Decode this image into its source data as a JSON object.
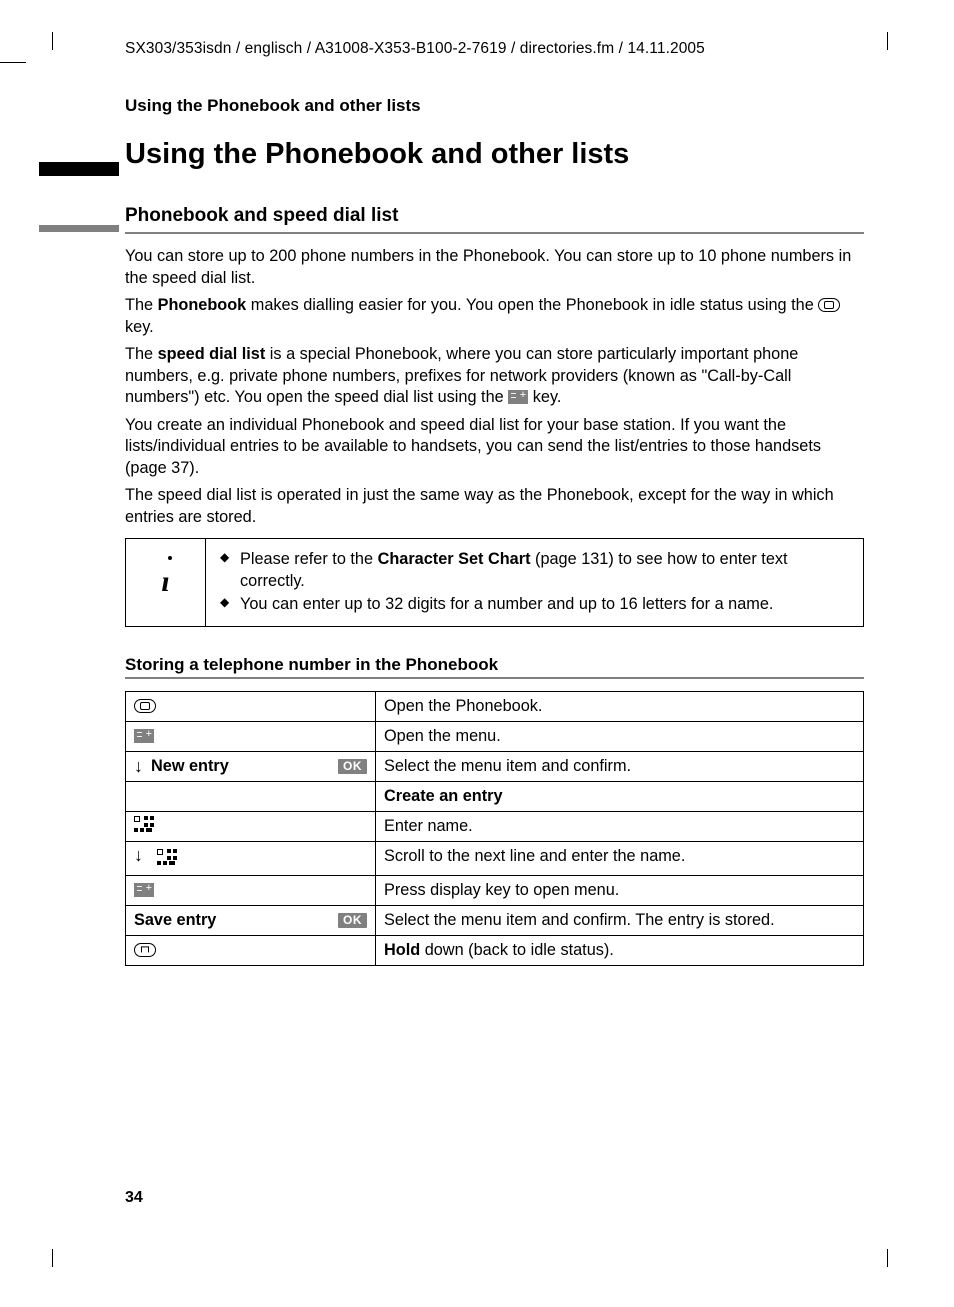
{
  "headerPath": "SX303/353isdn / englisch / A31008-X353-B100-2-7619 / directories.fm / 14.11.2005",
  "runningHead": "Using the Phonebook and other lists",
  "h1": "Using the Phonebook and other lists",
  "h2": "Phonebook and speed dial list",
  "para1": "You can store up to 200 phone numbers in the Phonebook. You can store up to 10 phone numbers in the speed dial list.",
  "para2a": "The ",
  "para2b": "Phonebook",
  "para2c": " makes dialling easier for you. You open the Phonebook in idle status using the ",
  "para2d": " key.",
  "para3a": "The ",
  "para3b": "speed dial list",
  "para3c": " is a special Phonebook, where you can store particularly important phone numbers, e.g. private phone numbers, prefixes for network providers (known as \"Call-by-Call numbers\") etc. You open the speed dial list using the ",
  "para3d": " key.",
  "para4": "You create an individual Phonebook and speed dial list for your base station. If you want the lists/individual entries to be available to handsets, you can send the list/entries to those handsets (page 37).",
  "para5": "The speed dial list is operated in just the same way as the Phonebook, except for the way in which entries are stored.",
  "info1a": "Please refer to the ",
  "info1b": "Character Set Chart",
  "info1c": " (page 131) to see how to enter text correctly.",
  "info2": "You can enter up to 32 digits for a number and up to 16 letters for a name.",
  "h3": "Storing a telephone number in the Phonebook",
  "ok": "OK",
  "steps": {
    "r1d": "Open the Phonebook.",
    "r2d": "Open the menu.",
    "r3k": "New entry",
    "r3d": "Select the menu item and confirm.",
    "r4d": "Create an entry",
    "r5d": "Enter name.",
    "r6d": "Scroll to the next line and enter the name.",
    "r7d": "Press display key to open menu.",
    "r8k": "Save entry",
    "r8d": "Select the menu item and confirm. The entry is stored.",
    "r9da": "Hold",
    "r9db": " down (back to idle status)."
  },
  "pageNumber": "34"
}
